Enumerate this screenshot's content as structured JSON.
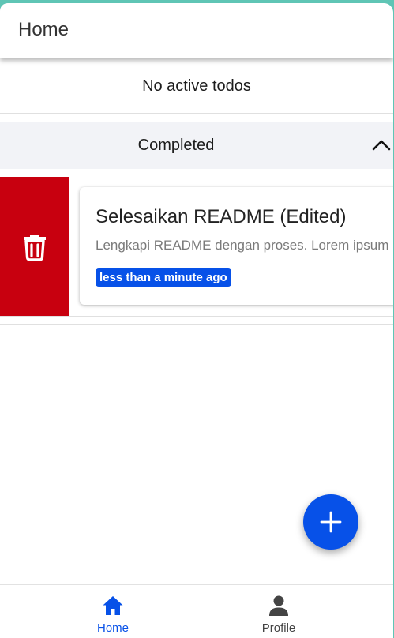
{
  "appbar": {
    "title": "Home"
  },
  "active_section": {
    "empty_message": "No active todos"
  },
  "completed_section": {
    "title": "Completed",
    "expanded": true,
    "items": [
      {
        "title": "Selesaikan README (Edited)",
        "description": "Lengkapi README dengan proses. Lorem ipsum",
        "timestamp": "less than a minute ago",
        "swipe_action": "delete"
      }
    ]
  },
  "fab": {
    "icon": "plus-icon"
  },
  "bottom_nav": {
    "items": [
      {
        "label": "Home",
        "icon": "home-icon",
        "selected": true
      },
      {
        "label": "Profile",
        "icon": "person-icon",
        "selected": false
      }
    ]
  },
  "colors": {
    "accent": "#0751e8",
    "delete": "#c8000f",
    "section_bg": "#f2f3f7",
    "frame": "#5fc5b5"
  }
}
